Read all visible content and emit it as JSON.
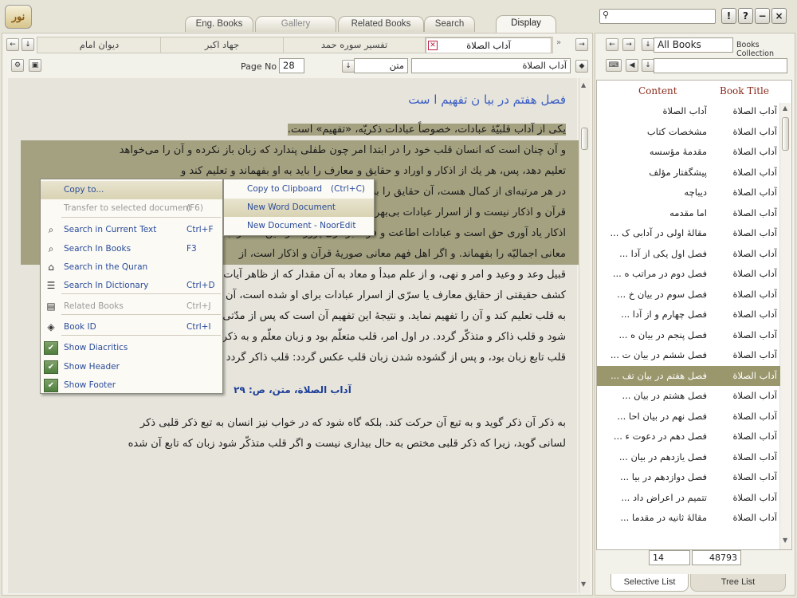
{
  "colors": {
    "highlight": "#a4a180",
    "accent_blue": "#3a5dc4",
    "menu_text": "#2a4b9a",
    "selected_row": "#9a976d"
  },
  "app": {
    "logo_text": "نور"
  },
  "main_tabs": [
    "Eng. Books",
    "Gallery",
    "Related Books",
    "Search",
    "Display"
  ],
  "active_main_tab": "Display",
  "top_buttons": [
    "!",
    "?",
    "−",
    "×"
  ],
  "doc_tabs": {
    "active": "آداب الصلاة",
    "others": [
      "تفسیر سوره حمد",
      "جهاد اکبر",
      "دیوان امام"
    ]
  },
  "toolbar": {
    "page_label": "Page No",
    "page_value": "28",
    "type_value": "متن",
    "title_value": "آداب الصلاة"
  },
  "right_panel": {
    "book_select": "All Books",
    "collection_label": "Books Collection",
    "search_placeholder": "",
    "col_content": "Content",
    "col_title": "Book Title",
    "page_current": "14",
    "page_total": "48793",
    "bottom_tabs": [
      "Selective List",
      "Tree List"
    ]
  },
  "toc": [
    {
      "content": "آداب الصلاة",
      "title": "آداب الصلاة"
    },
    {
      "content": "مشخصات كتاب",
      "title": "آداب الصلاة"
    },
    {
      "content": "مقدمهٔ مؤسسه",
      "title": "آداب الصلاة"
    },
    {
      "content": "پیشگفتار مؤلف",
      "title": "آداب الصلاة"
    },
    {
      "content": "دیباچه",
      "title": "آداب الصلاة"
    },
    {
      "content": "اما مقدمه",
      "title": "آداب الصلاة"
    },
    {
      "content": "مقالهٔ اولی در آدابی ک ...",
      "title": "آداب الصلاة"
    },
    {
      "content": "فصل اول یكی از آدا ...",
      "title": "آداب الصلاة"
    },
    {
      "content": "فصل دوم در مراتب ه ...",
      "title": "آداب الصلاة"
    },
    {
      "content": "فصل سوم در بیان خ ...",
      "title": "آداب الصلاة"
    },
    {
      "content": "فصل چهارم و از آدا ...",
      "title": "آداب الصلاة"
    },
    {
      "content": "فصل پنجم در بیان ه ...",
      "title": "آداب الصلاة"
    },
    {
      "content": "فصل ششم در بیان ت ...",
      "title": "آداب الصلاة"
    },
    {
      "content": "فصل هفتم در بیان تف ...",
      "title": "آداب الصلاة"
    },
    {
      "content": "فصل هشتم در بیان ...",
      "title": "آداب الصلاة"
    },
    {
      "content": "فصل نهم در بیان احا ...",
      "title": "آداب الصلاة"
    },
    {
      "content": "فصل دهم در دعوت ء ...",
      "title": "آداب الصلاة"
    },
    {
      "content": "فصل یازدهم در بیان ...",
      "title": "آداب الصلاة"
    },
    {
      "content": "فصل دوازدهم در بیا ...",
      "title": "آداب الصلاة"
    },
    {
      "content": "تتمیم در اعراض داد ...",
      "title": "آداب الصلاة"
    },
    {
      "content": "مقالهٔ ثانیه در مقدما ...",
      "title": "آداب الصلاة"
    }
  ],
  "document": {
    "heading": "فصل هفتم در بیا ن تفهیم ا ست",
    "footer_ref": "آداب الصلاة، متن، ص: ۲۹",
    "lines": [
      "یكی از آداب قلبیّهٔ عبادات، خصوصاً عبادات ذكریّه، «تفهیم» است.",
      "و آن چنان است كه انسان قلب خود را در ابتدا امر چون طفلی پندارد كه زبان باز نكرده و آن را می‌خواهد",
      "تعلیم دهد، پس، هر یك از اذكار و اوراد و حقایق و معارف را باید به او بفهماند و تعلیم كند و",
      "در هر مرتبه‌ای از كمال هست، آن حقایق را به قلب برساند و زبان او را به آن باز كند. فانی",
      "قرآن و اذكار نیست و از اسرار عبادات بی‌بهره است، همان معنای اجمالی آن را به قلب برساند و",
      "اذكار یاد آوری حق است و عبادات اطاعت و فرمانبرداری پروردگار، این معنا را به قلب بفهماند و این",
      "معانی اجمالیّه را بفهماند. و اگر اهل فهم معانی صوریهٔ قرآن و اذكار است، از",
      "قبیل وعد و وعید و امر و نهی، و از علم مبدأ و معاد به آن مقدار كه از ظاهر آیات و اخبار فهمیده است، و اگر",
      "كشف حقیقتی از حقایق معارف یا سرّی از اسرار عبادات برای او شده است، آن را به تدریج و با آرامش",
      "به قلب تعلیم كند و آن را تفهیم نماید. و نتیجهٔ این تفهیم آن است كه پس از مدّتی مواظبت زبان قلب گشوده",
      "شود و قلب ذاكر و متذكّر گردد. در اول امر، قلب متعلّم بود و زبان معلّم و به ذكر زبان قلب ذاكر می شد و",
      "قلب تابع زبان بود، و پس از گشوده شدن زبان قلب عكس گردد: قلب ذاكر گردد و زبان",
      "به ذكر آن ذكر گوید و به تبع آن حركت كند. بلكه گاه شود كه در خواب نیز انسان به تبع ذكر قلبی ذكر",
      "لسانی گوید، زیرا كه ذكر قلبی مختص به حال بیداری نیست و اگر قلب متذكّر شود زبان كه تابع آن شده"
    ]
  },
  "context_menu": {
    "items": [
      {
        "label": "Copy to...",
        "shortcut": "",
        "icon": "",
        "enabled": true
      },
      {
        "label": "Transfer to selected document",
        "shortcut": "(F6)",
        "icon": "",
        "enabled": false
      },
      {
        "label": "Search in Current Text",
        "shortcut": "Ctrl+F",
        "icon": "magnifier-icon",
        "enabled": true
      },
      {
        "label": "Search In Books",
        "shortcut": "F3",
        "icon": "magnifier-icon",
        "enabled": true
      },
      {
        "label": "Search in the Quran",
        "shortcut": "",
        "icon": "quran-icon",
        "enabled": true
      },
      {
        "label": "Search In Dictionary",
        "shortcut": "Ctrl+D",
        "icon": "dictionary-icon",
        "enabled": true
      },
      {
        "label": "Related Books",
        "shortcut": "Ctrl+J",
        "icon": "books-icon",
        "enabled": false
      },
      {
        "label": "Book ID",
        "shortcut": "Ctrl+I",
        "icon": "tag-icon",
        "enabled": true
      },
      {
        "label": "Show Diacritics",
        "shortcut": "",
        "icon": "check-icon",
        "enabled": true
      },
      {
        "label": "Show Header",
        "shortcut": "",
        "icon": "check-icon",
        "enabled": true
      },
      {
        "label": "Show Footer",
        "shortcut": "",
        "icon": "check-icon",
        "enabled": true
      }
    ],
    "submenu": [
      {
        "label": "Copy to Clipboard",
        "shortcut": "(Ctrl+C)"
      },
      {
        "label": "New Word Document",
        "shortcut": ""
      },
      {
        "label": "New Document - NoorEdit",
        "shortcut": ""
      }
    ]
  }
}
